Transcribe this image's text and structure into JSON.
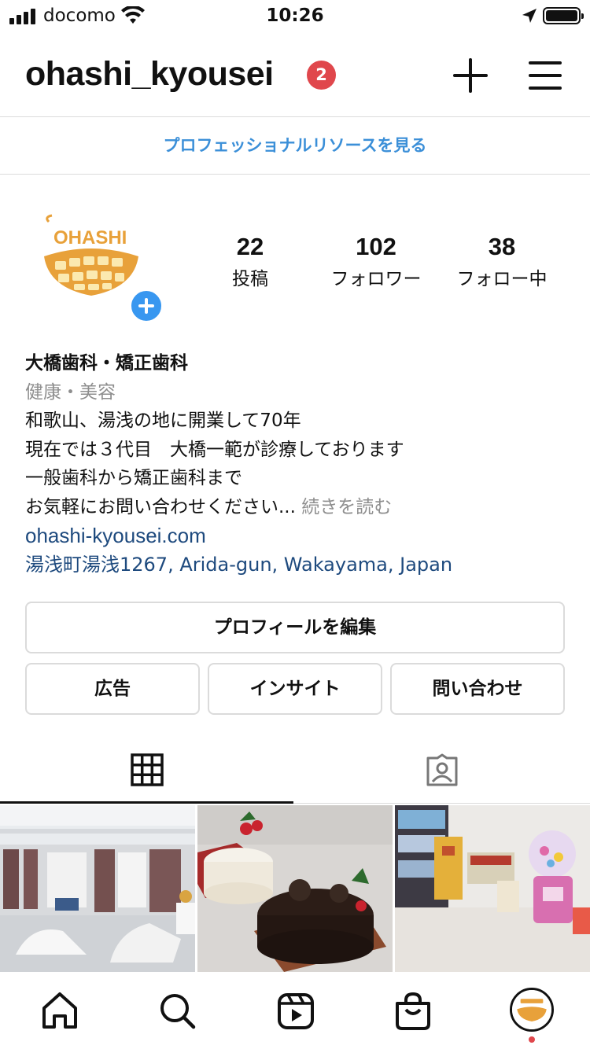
{
  "status_bar": {
    "carrier": "docomo",
    "time": "10:26"
  },
  "header": {
    "username": "ohashi_kyousei",
    "notification_count": "2"
  },
  "pro_banner": {
    "label": "プロフェッショナルリソースを見る"
  },
  "avatar": {
    "logo_text": "OHASHI"
  },
  "stats": [
    {
      "value": "22",
      "label": "投稿"
    },
    {
      "value": "102",
      "label": "フォロワー"
    },
    {
      "value": "38",
      "label": "フォロー中"
    }
  ],
  "bio": {
    "name": "大橋歯科・矯正歯科",
    "category": "健康・美容",
    "lines": [
      "和歌山、湯浅の地に開業して70年",
      "現在では３代目　大橋一範が診療しております",
      "一般歯科から矯正歯科まで",
      "お気軽にお問い合わせください..."
    ],
    "more": "続きを読む",
    "link": "ohashi-kyousei.com",
    "address": "湯浅町湯浅1267, Arida-gun, Wakayama, Japan"
  },
  "buttons": {
    "edit_profile": "プロフィールを編集",
    "ads": "広告",
    "insights": "インサイト",
    "contact": "問い合わせ"
  },
  "tabs": [
    {
      "icon": "grid-icon",
      "active": true
    },
    {
      "icon": "tagged-icon",
      "active": false
    }
  ],
  "posts": [
    {
      "subject": "dental clinic treatment room"
    },
    {
      "subject": "christmas cakes"
    },
    {
      "subject": "kids corner with toys"
    }
  ],
  "bottom_nav": [
    {
      "icon": "home-icon"
    },
    {
      "icon": "search-icon"
    },
    {
      "icon": "reels-icon"
    },
    {
      "icon": "shop-icon"
    },
    {
      "icon": "profile-avatar-icon"
    }
  ],
  "colors": {
    "accent_blue": "#3897f0",
    "link_blue": "#1e4a7e",
    "badge_red": "#e0474c",
    "logo_gold": "#e8a13a"
  }
}
